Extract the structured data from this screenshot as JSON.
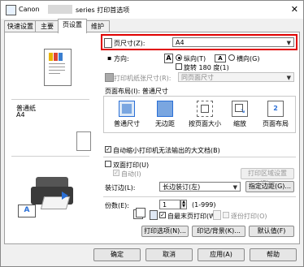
{
  "window": {
    "title": "Canon",
    "title_suffix": "series 打印首选项"
  },
  "tabs": [
    {
      "label": "快速设置"
    },
    {
      "label": "主要"
    },
    {
      "label": "页设置"
    },
    {
      "label": "维护"
    }
  ],
  "preview": {
    "media_type": "普通纸",
    "paper_size": "A4"
  },
  "page_setup": {
    "page_size_label": "页尺寸(Z):",
    "page_size_value": "A4",
    "orientation_label": "方向:",
    "portrait_label": "纵向(T)",
    "landscape_label": "横向(G)",
    "rotate_label": "旋转 180 度(1)",
    "printer_paper_label": "打印机纸张尺寸(R):",
    "printer_paper_value": "同页面尺寸",
    "layout_group_label": "页面布局(I): 普通尺寸",
    "layouts": [
      {
        "label": "普通尺寸"
      },
      {
        "label": "无边距"
      },
      {
        "label": "按页面大小"
      },
      {
        "label": "缩放"
      },
      {
        "label": "页面布局"
      }
    ],
    "layout_number": "2",
    "auto_reduce_label": "自动缩小打印机无法输出的大文档(B)",
    "duplex_label": "双面打印(U)",
    "auto_label": "自动(I)",
    "print_area_button": "打印区域设置(P)...",
    "binding_label": "装订边(L):",
    "binding_value": "长边装订(左)",
    "margin_button": "指定边距(G)...",
    "copies_label": "份数(E):",
    "copies_value": "1",
    "copies_range": "(1-999)",
    "last_page_first_label": "自最末页打印(W)",
    "collate_label": "逐份打印(O)",
    "print_options_button": "打印选项(N)...",
    "stamp_button": "印记/背景(K)...",
    "defaults_button": "默认值(F)"
  },
  "footer": {
    "ok": "确定",
    "cancel": "取消",
    "apply": "应用(A)",
    "help": "帮助"
  },
  "colors": {
    "highlight": "#e00000",
    "accent": "#2a6fd6"
  }
}
